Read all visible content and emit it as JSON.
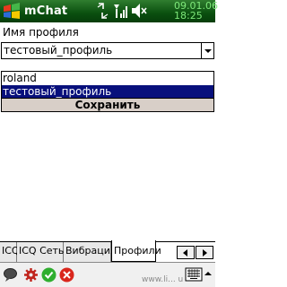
{
  "titlebar": {
    "app_title": "mChat",
    "date": "09.01.06",
    "time": "18:25"
  },
  "form": {
    "profile_label": "Имя профиля",
    "selected_profile": "тестовый_профиль",
    "options": [
      "roland",
      "тестовый_профиль"
    ],
    "save_label": "Сохранить"
  },
  "tabs": [
    {
      "label": "ICQ"
    },
    {
      "label": "ICQ Сеть"
    },
    {
      "label": "Вибрация"
    },
    {
      "label": "Профили",
      "active": true
    }
  ],
  "toolbar": {
    "watermark": "www.li... u"
  },
  "colors": {
    "titlebar": "#0a4f0f",
    "selection": "#08107c",
    "clock": "#7ee87a"
  }
}
